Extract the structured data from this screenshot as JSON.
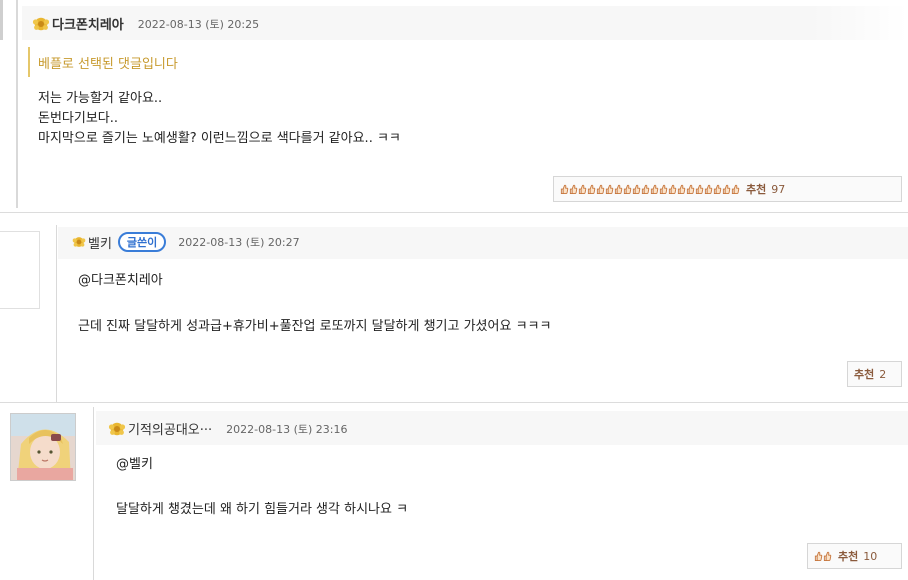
{
  "colors": {
    "best_label": "#c79a2e",
    "author_badge": "#3a7dd8",
    "recommend_text": "#8a5a3c",
    "header_bg": "#f7f7f7"
  },
  "comments": [
    {
      "nickname": "다크폰치레아",
      "date": "2022-08-13 (토) 20:25",
      "medal_icon": "flower-medal-icon",
      "best_label": "베플로 선택된 댓글입니다",
      "lines": [
        "저는 가능할거 같아요..",
        "돈번다기보다..",
        "마지막으로 즐기는 노예생활? 이런느낌으로 색다를거 같아요.. ㅋㅋ"
      ],
      "recommend_label": "추천",
      "recommend_count": "97",
      "thumb_icon_count": 20
    },
    {
      "nickname": "벨키",
      "author_badge": "글쓴이",
      "date": "2022-08-13 (토) 20:27",
      "medal_icon": "flower-medal-icon",
      "mention": "@다크폰치레아",
      "text": "근데 진짜 달달하게 성과급+휴가비+풀잔업 로또까지 달달하게 챙기고 가셨어요 ㅋㅋㅋ",
      "recommend_label": "추천",
      "recommend_count": "2",
      "thumb_icon_count": 0
    },
    {
      "nickname": "기적의공대오···",
      "date": "2022-08-13 (토) 23:16",
      "medal_icon": "flower-medal-icon",
      "mention": "@벨키",
      "text": "달달하게 챙겼는데 왜 하기 힘들거라 생각 하시나요 ㅋ",
      "recommend_label": "추천",
      "recommend_count": "10",
      "thumb_icon_count": 2
    }
  ]
}
